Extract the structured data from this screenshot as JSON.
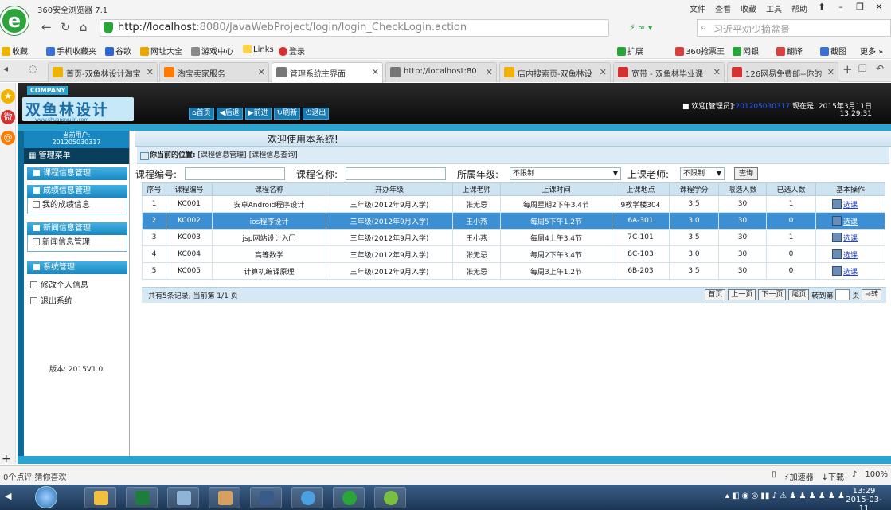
{
  "browser": {
    "app_title": "360安全浏览器 7.1",
    "sys_menu": [
      "文件",
      "查看",
      "收藏",
      "工具",
      "帮助"
    ],
    "address": "http://localhost:8080/JavaWebProject/login/login_CheckLogin.action",
    "address_host": "http://localhost",
    "address_rest": ":8080/JavaWebProject/login/login_CheckLogin.action",
    "address_icons": "扩展",
    "search_placeholder": "习近平劝少摘盆景",
    "bookmarks": [
      {
        "label": "收藏",
        "color": "#f0b400"
      },
      {
        "label": "手机收藏夹",
        "color": "#3a6fd8"
      },
      {
        "label": "谷歌",
        "color": "#2f66d0"
      },
      {
        "label": "网址大全",
        "color": "#e8a800"
      },
      {
        "label": "游戏中心",
        "color": "#888888"
      },
      {
        "label": "Links",
        "color": "#ffd24a"
      },
      {
        "label": "登录",
        "color": "#d83030"
      }
    ],
    "bookmarks_right": [
      {
        "label": "扩展",
        "color": "#2aa53a"
      },
      {
        "label": "360抢票王",
        "color": "#d84040"
      },
      {
        "label": "网银",
        "color": "#2aa53a"
      },
      {
        "label": "翻译",
        "color": "#d84040"
      },
      {
        "label": "截图",
        "color": "#3a6fd8"
      },
      {
        "label": "更多",
        "color": "#777777"
      }
    ],
    "tabs": [
      {
        "label": "首页-双鱼林设计淘宝",
        "color": "#f0b400",
        "active": false
      },
      {
        "label": "淘宝卖家服务",
        "color": "#ff7a00",
        "active": false
      },
      {
        "label": "管理系统主界面",
        "color": "#777777",
        "active": true
      },
      {
        "label": "http://localhost:80",
        "color": "#777777",
        "active": false
      },
      {
        "label": "店内搜索页-双鱼林设",
        "color": "#f0b400",
        "active": false
      },
      {
        "label": "宽带 - 双鱼林毕业课",
        "color": "#d83030",
        "active": false
      },
      {
        "label": "126网易免费邮--你的",
        "color": "#d83030",
        "active": false
      }
    ],
    "status_left": "0个点评    猜你喜欢",
    "status_right": [
      "加速器",
      "下载",
      "100%"
    ]
  },
  "app": {
    "company": "COMPANY",
    "brand": "双鱼林设计",
    "brand_url": "www.shuangyulin.com",
    "topnav": [
      "首页",
      "后退",
      "前进",
      "刷新",
      "退出"
    ],
    "welcome_user": "■ 欢迎[管理员]:",
    "user_id": "201205030317",
    "now_label": "现在是: 2015年3月11日",
    "time": "13:29:31",
    "current_user_label": "当前用户:",
    "current_user": "201205030317",
    "menu_title": "管理菜单",
    "menu_groups": [
      {
        "title": "课程信息管理"
      },
      {
        "title": "成绩信息管理",
        "items": [
          "我的成绩信息"
        ]
      },
      {
        "title": "新闻信息管理",
        "items": [
          "新闻信息管理"
        ]
      },
      {
        "title": "系统管理",
        "items": [
          "修改个人信息",
          "退出系统"
        ]
      }
    ],
    "version": "版本: 2015V1.0",
    "main_welcome": "欢迎使用本系统!",
    "location_label": "你当前的位置:",
    "location_path": "[课程信息管理]-[课程信息查询]",
    "filters": {
      "course_no_label": "课程编号:",
      "course_name_label": "课程名称:",
      "grade_label": "所属年级:",
      "grade_value": "不限制",
      "teacher_label": "上课老师:",
      "teacher_value": "不限制",
      "query": "查询"
    },
    "columns": [
      "序号",
      "课程编号",
      "课程名称",
      "开办年级",
      "上课老师",
      "上课时间",
      "上课地点",
      "课程学分",
      "限选人数",
      "已选人数",
      "基本操作"
    ],
    "rows": [
      {
        "no": "1",
        "code": "KC001",
        "name": "安卓Android程序设计",
        "grade": "三年级(2012年9月入学)",
        "teacher": "张无忌",
        "time": "每周星期2下午3,4节",
        "place": "9教学楼304",
        "credit": "3.5",
        "limit": "30",
        "chosen": "1",
        "op": "选课"
      },
      {
        "no": "2",
        "code": "KC002",
        "name": "ios程序设计",
        "grade": "三年级(2012年9月入学)",
        "teacher": "王小燕",
        "time": "每周5下午1,2节",
        "place": "6A-301",
        "credit": "3.0",
        "limit": "30",
        "chosen": "0",
        "op": "选课"
      },
      {
        "no": "3",
        "code": "KC003",
        "name": "jsp网站设计入门",
        "grade": "三年级(2012年9月入学)",
        "teacher": "王小燕",
        "time": "每周4上午3,4节",
        "place": "7C-101",
        "credit": "3.5",
        "limit": "30",
        "chosen": "1",
        "op": "选课"
      },
      {
        "no": "4",
        "code": "KC004",
        "name": "高等数学",
        "grade": "三年级(2012年9月入学)",
        "teacher": "张无忌",
        "time": "每周2下午3,4节",
        "place": "8C-103",
        "credit": "3.0",
        "limit": "30",
        "chosen": "0",
        "op": "选课"
      },
      {
        "no": "5",
        "code": "KC005",
        "name": "计算机编译原理",
        "grade": "三年级(2012年9月入学)",
        "teacher": "张无忌",
        "time": "每周3上午1,2节",
        "place": "6B-203",
        "credit": "3.5",
        "limit": "30",
        "chosen": "0",
        "op": "选课"
      }
    ],
    "pager_info": "共有5条记录, 当前第 1/1 页",
    "pager": {
      "first": "首页",
      "prev": "上一页",
      "next": "下一页",
      "last": "尾页",
      "goto": "转到第",
      "page_unit": "页",
      "go": "转"
    }
  },
  "taskbar": {
    "clock_time": "13:29",
    "clock_date": "2015-03-11"
  }
}
